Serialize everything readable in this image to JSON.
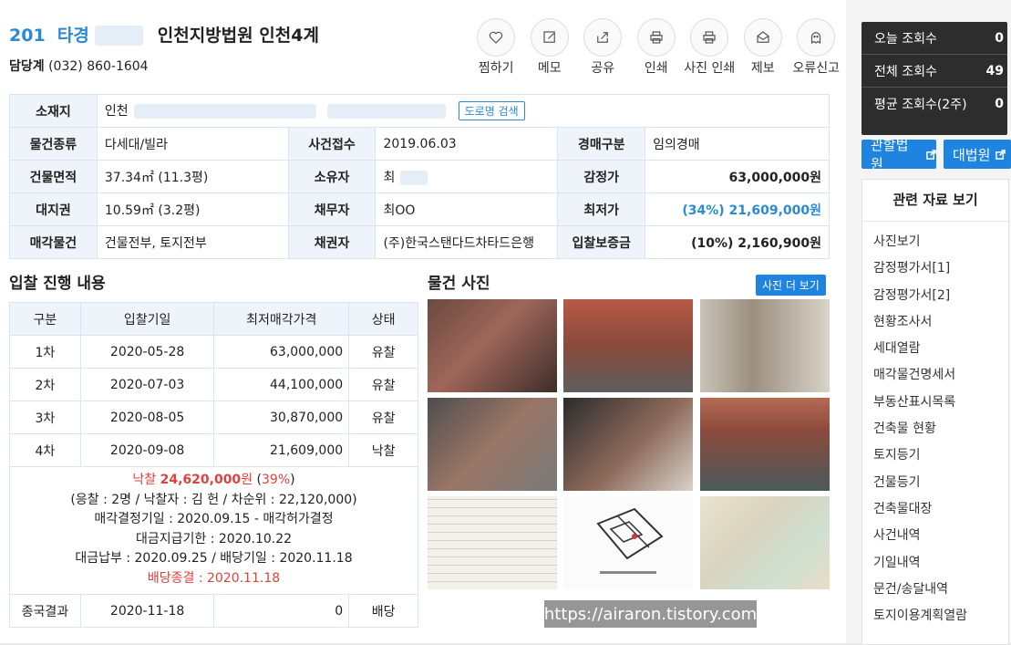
{
  "header": {
    "case_no": "201",
    "case_suffix": "타경",
    "court": "인천지방법원 인천4계",
    "contact_label": "담당계",
    "contact_phone": "(032) 860-1604"
  },
  "actions": [
    {
      "label": "찜하기",
      "icon": "heart-icon"
    },
    {
      "label": "메모",
      "icon": "pencil-icon"
    },
    {
      "label": "공유",
      "icon": "share-icon"
    },
    {
      "label": "인쇄",
      "icon": "printer-icon"
    },
    {
      "label": "사진 인쇄",
      "icon": "printer-icon"
    },
    {
      "label": "제보",
      "icon": "envelope-icon"
    },
    {
      "label": "오류신고",
      "icon": "ghost-icon"
    }
  ],
  "info": {
    "address_label": "소재지",
    "address_value": "인천",
    "road_search": "도로명 검색",
    "type_label": "물건종류",
    "type_value": "다세대/빌라",
    "received_label": "사건접수",
    "received_value": "2019.06.03",
    "auction_type_label": "경매구분",
    "auction_type_value": "임의경매",
    "area_label": "건물면적",
    "area_value": "37.34㎡ (11.3평)",
    "owner_label": "소유자",
    "owner_value": "최",
    "appraisal_label": "감정가",
    "appraisal_value": "63,000,000원",
    "land_label": "대지권",
    "land_value": "10.59㎡ (3.2평)",
    "debtor_label": "채무자",
    "debtor_value": "최OO",
    "min_label": "최저가",
    "min_value": "(34%) 21,609,000원",
    "sale_label": "매각물건",
    "sale_value": "건물전부, 토지전부",
    "creditor_label": "채권자",
    "creditor_value": "(주)한국스탠다드차타드은행",
    "deposit_label": "입찰보증금",
    "deposit_value": "(10%) 2,160,900원"
  },
  "bid": {
    "title": "입찰 진행 내용",
    "headers": [
      "구분",
      "입찰기일",
      "최저매각가격",
      "상태"
    ],
    "rows": [
      [
        "1차",
        "2020-05-28",
        "63,000,000",
        "유찰"
      ],
      [
        "2차",
        "2020-07-03",
        "44,100,000",
        "유찰"
      ],
      [
        "3차",
        "2020-08-05",
        "30,870,000",
        "유찰"
      ],
      [
        "4차",
        "2020-09-08",
        "21,609,000",
        "낙찰"
      ]
    ],
    "winning_label": "낙찰",
    "winning_price": "24,620,000",
    "winning_unit": "원",
    "winning_pct": "39%",
    "detail1": "(응찰 : 2명 / 낙찰자 : 김   헌 / 차순위 : 22,120,000)",
    "detail2": "매각결정기일 : 2020.09.15 - 매각허가결정",
    "detail3": "대금지급기한 : 2020.10.22",
    "detail4": "대금납부 : 2020.09.25 / 배당기일 : 2020.11.18",
    "detail5": "배당종결 : 2020.11.18",
    "final": [
      "종국결과",
      "2020-11-18",
      "0",
      "배당"
    ]
  },
  "photos": {
    "title": "물건 사진",
    "more": "사진 더 보기"
  },
  "watermark": "https://airaron.tistory.com",
  "stats": {
    "today_label": "오늘 조회수",
    "today_value": "0",
    "total_label": "전체 조회수",
    "total_value": "49",
    "avg_label": "평균 조회수(2주)",
    "avg_value": "0"
  },
  "court_links": [
    "관할법원",
    "대법원"
  ],
  "docs": {
    "title": "관련 자료 보기",
    "items": [
      "사진보기",
      "감정평가서[1]",
      "감정평가서[2]",
      "현황조사서",
      "세대열람",
      "매각물건명세서",
      "부동산표시목록",
      "건축물 현황",
      "토지등기",
      "건물등기",
      "건축물대장",
      "사건내역",
      "기일내역",
      "문건/송달내역",
      "토지이용계획열람"
    ]
  },
  "colors": {
    "accent": "#1f84e0",
    "link_blue": "#2b8ad6",
    "red": "#e0413a",
    "th_bg": "#eef4fa"
  }
}
